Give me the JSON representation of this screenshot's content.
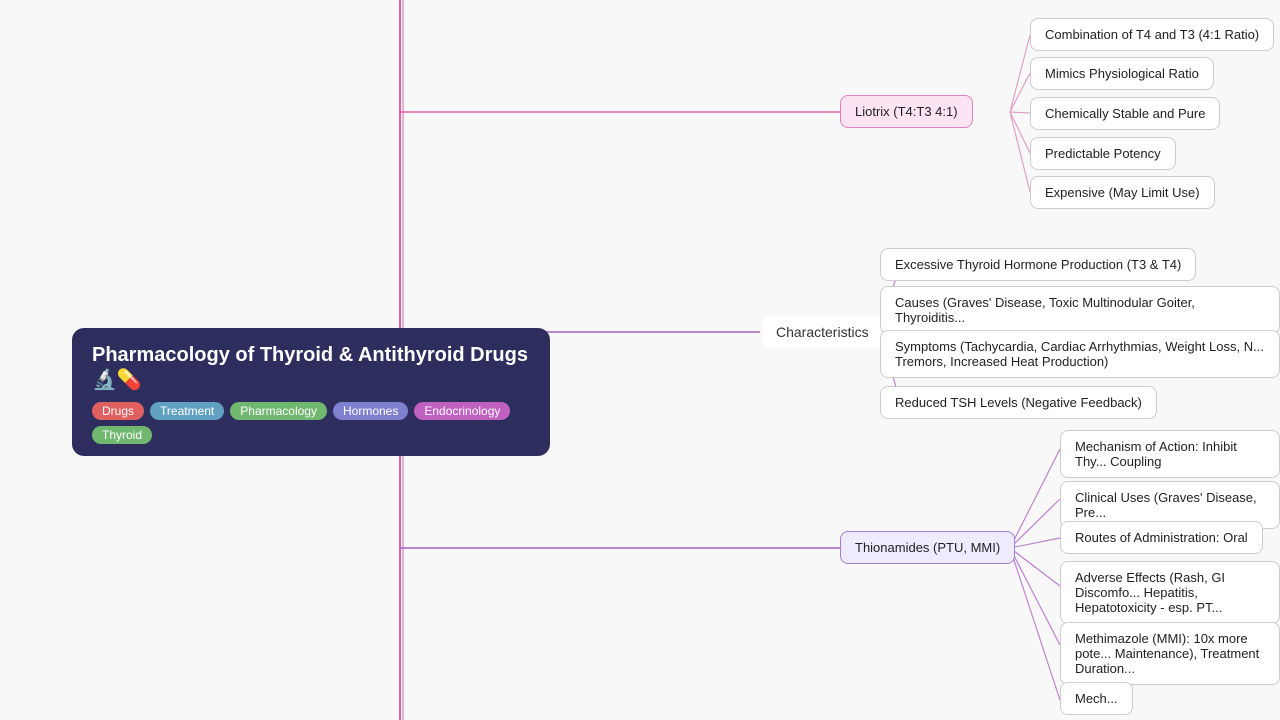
{
  "title": {
    "text": "Pharmacology of Thyroid & Antithyroid Drugs 🔬💊",
    "tags": [
      {
        "label": "Drugs",
        "class": "tag-drugs"
      },
      {
        "label": "Treatment",
        "class": "tag-treatment"
      },
      {
        "label": "Pharmacology",
        "class": "tag-pharmacology"
      },
      {
        "label": "Hormones",
        "class": "tag-hormones"
      },
      {
        "label": "Endocrinology",
        "class": "tag-endocrinology"
      },
      {
        "label": "Thyroid",
        "class": "tag-thyroid"
      }
    ]
  },
  "nodes": {
    "liotrix": {
      "label": "Liotrix (T4:T3 4:1)",
      "children": [
        "Combination of T4 and T3 (4:1 Ratio)",
        "Mimics Physiological Ratio",
        "Chemically Stable and Pure",
        "Predictable Potency",
        "Expensive (May Limit Use)"
      ]
    },
    "characteristics": {
      "label": "Characteristics",
      "children": [
        "Excessive Thyroid Hormone Production (T3 & T4)",
        "Causes (Graves' Disease, Toxic Multinodular Goiter, Thyroiditis...",
        "Symptoms (Tachycardia, Cardiac Arrhythmias, Weight Loss, N... Tremors, Increased Heat Production)",
        "Reduced TSH Levels (Negative Feedback)"
      ]
    },
    "thionamides": {
      "label": "Thionamides (PTU, MMI)",
      "children": [
        "Mechanism of Action: Inhibit Thy... Coupling",
        "Clinical Uses (Graves' Disease, Pre...",
        "Routes of Administration: Oral",
        "Adverse Effects (Rash, GI Discomfo... Hepatitis, Hepatotoxicity - esp. PT...",
        "Methimazole (MMI): 10x more pote... Maintenance), Treatment Duration...",
        "Mech..."
      ]
    }
  }
}
